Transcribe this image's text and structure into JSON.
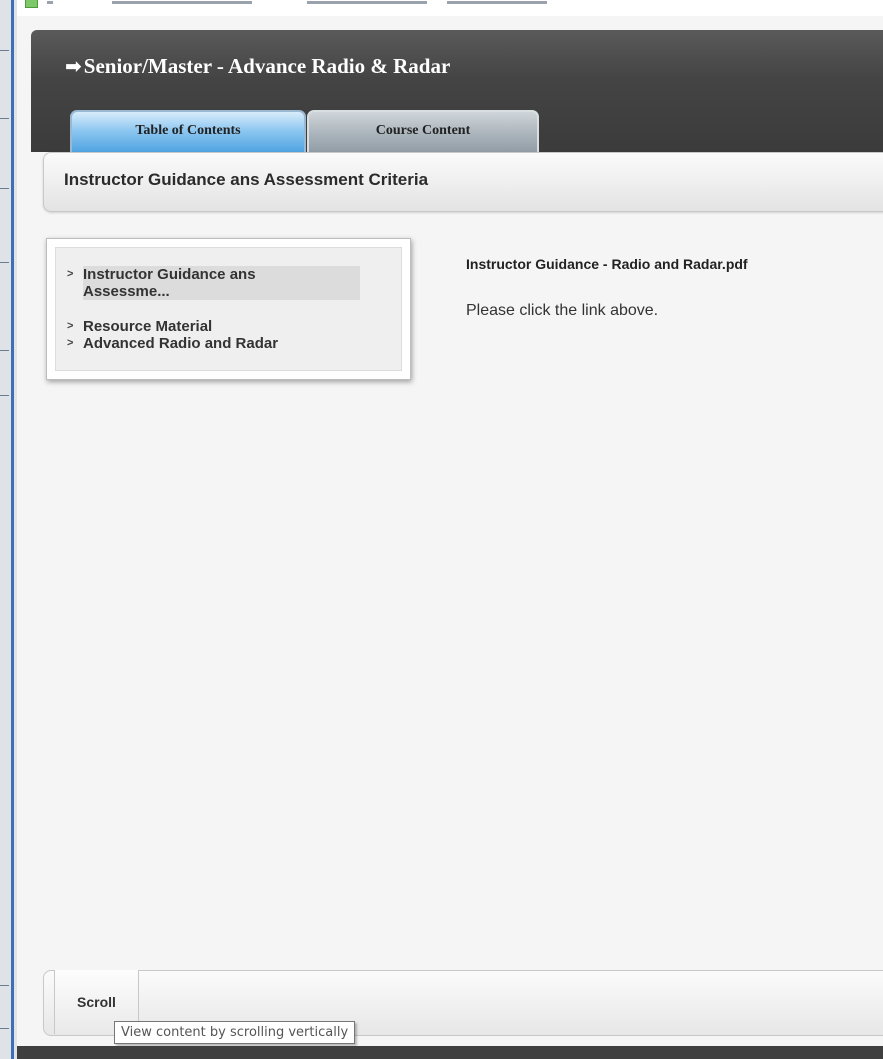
{
  "app": {
    "title": "Senior/Master - Advance Radio & Radar",
    "tabs": [
      {
        "label": "Table of Contents",
        "active": true
      },
      {
        "label": "Course Content",
        "active": false
      }
    ]
  },
  "section": {
    "title": "Instructor Guidance ans Assessment Criteria"
  },
  "toc": {
    "items": [
      {
        "label_line1": "Instructor Guidance ans",
        "label_line2": "Assessme...",
        "active": true
      },
      {
        "label": "Resource Material"
      },
      {
        "label": "Advanced Radio and Radar"
      }
    ]
  },
  "content": {
    "link_text": "Instructor Guidance - Radio and Radar.pdf",
    "instruction": "Please click the link above."
  },
  "footer": {
    "scroll_label": "Scroll",
    "tooltip": "View content by scrolling vertically"
  },
  "colors": {
    "header_bg": "#444444",
    "tab_active": "#4aa0e0",
    "tab_inactive": "#a9b3ba"
  }
}
